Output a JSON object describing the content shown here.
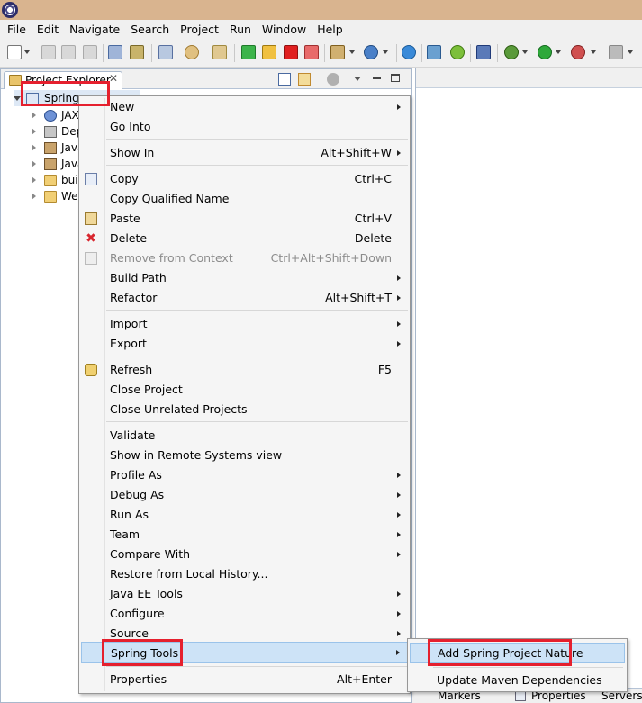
{
  "menubar": [
    "File",
    "Edit",
    "Navigate",
    "Search",
    "Project",
    "Run",
    "Window",
    "Help"
  ],
  "explorer": {
    "tab_title": "Project Explorer",
    "close_glyph": "✕",
    "tree": [
      {
        "label": "Spring",
        "icon": "project-icon",
        "expanded": true
      },
      {
        "label": "JAX",
        "icon": "web-service-icon"
      },
      {
        "label": "Dep",
        "icon": "deployment-icon"
      },
      {
        "label": "Java",
        "icon": "java-resources-icon"
      },
      {
        "label": "Java",
        "icon": "library-icon"
      },
      {
        "label": "bui",
        "icon": "folder-icon"
      },
      {
        "label": "We",
        "icon": "folder-icon"
      }
    ]
  },
  "context_menu": {
    "items": [
      {
        "label": "New",
        "shortcut": "",
        "submenu": true
      },
      {
        "label": "Go Into",
        "shortcut": ""
      },
      {
        "label": "Show In",
        "shortcut": "Alt+Shift+W",
        "submenu": true
      },
      {
        "label": "Copy",
        "shortcut": "Ctrl+C",
        "icon": "copy-icon"
      },
      {
        "label": "Copy Qualified Name",
        "shortcut": ""
      },
      {
        "label": "Paste",
        "shortcut": "Ctrl+V",
        "icon": "paste-icon"
      },
      {
        "label": "Delete",
        "shortcut": "Delete",
        "icon": "delete-icon"
      },
      {
        "label": "Remove from Context",
        "shortcut": "Ctrl+Alt+Shift+Down",
        "disabled": true,
        "icon": "remove-context-icon"
      },
      {
        "label": "Build Path",
        "shortcut": "",
        "submenu": true
      },
      {
        "label": "Refactor",
        "shortcut": "Alt+Shift+T",
        "submenu": true
      },
      {
        "label": "Import",
        "shortcut": "",
        "submenu": true
      },
      {
        "label": "Export",
        "shortcut": "",
        "submenu": true
      },
      {
        "label": "Refresh",
        "shortcut": "F5",
        "icon": "refresh-icon"
      },
      {
        "label": "Close Project",
        "shortcut": ""
      },
      {
        "label": "Close Unrelated Projects",
        "shortcut": ""
      },
      {
        "label": "Validate",
        "shortcut": ""
      },
      {
        "label": "Show in Remote Systems view",
        "shortcut": ""
      },
      {
        "label": "Profile As",
        "shortcut": "",
        "submenu": true
      },
      {
        "label": "Debug As",
        "shortcut": "",
        "submenu": true
      },
      {
        "label": "Run As",
        "shortcut": "",
        "submenu": true
      },
      {
        "label": "Team",
        "shortcut": "",
        "submenu": true
      },
      {
        "label": "Compare With",
        "shortcut": "",
        "submenu": true
      },
      {
        "label": "Restore from Local History...",
        "shortcut": ""
      },
      {
        "label": "Java EE Tools",
        "shortcut": "",
        "submenu": true
      },
      {
        "label": "Configure",
        "shortcut": "",
        "submenu": true
      },
      {
        "label": "Source",
        "shortcut": "",
        "submenu": true
      },
      {
        "label": "Spring Tools",
        "shortcut": "",
        "submenu": true,
        "highlighted": true
      },
      {
        "label": "Properties",
        "shortcut": "Alt+Enter"
      }
    ]
  },
  "submenu": {
    "items": [
      {
        "label": "Add Spring Project Nature",
        "highlighted": true
      },
      {
        "label": "Update Maven Dependencies"
      }
    ]
  },
  "bottom_tabs": [
    "Markers",
    "Properties",
    "Servers"
  ],
  "colors": {
    "highlight_box": "#e5202e",
    "menu_hover": "#cde3f7",
    "title_strip": "#d9b48f"
  }
}
